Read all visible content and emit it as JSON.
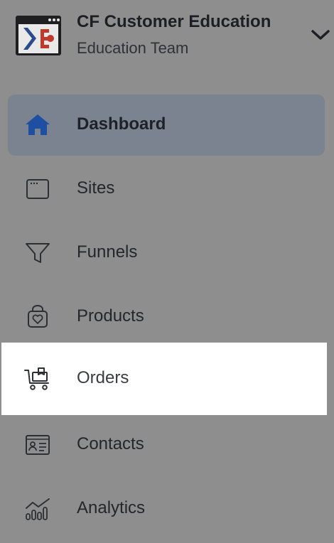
{
  "org": {
    "name": "CF Customer Education",
    "team": "Education Team",
    "logo_icon": "clickfunnels-logo-icon",
    "dropdown_icon": "chevron-down-icon"
  },
  "nav": {
    "items": [
      {
        "label": "Dashboard",
        "icon": "home-icon",
        "state": "active"
      },
      {
        "label": "Sites",
        "icon": "browser-window-icon"
      },
      {
        "label": "Funnels",
        "icon": "funnel-icon"
      },
      {
        "label": "Products",
        "icon": "product-bag-icon"
      },
      {
        "label": "Orders",
        "icon": "cart-icon",
        "state": "highlighted"
      },
      {
        "label": "Contacts",
        "icon": "contact-card-icon"
      },
      {
        "label": "Analytics",
        "icon": "analytics-icon"
      }
    ]
  },
  "colors": {
    "overlay_background": "#8e8e8e",
    "active_background": "#7a838f",
    "highlight_background": "#ffffff",
    "home_icon_blue": "#1e4fa3",
    "logo_red": "#c0392b",
    "logo_blue": "#2b4c8c"
  }
}
